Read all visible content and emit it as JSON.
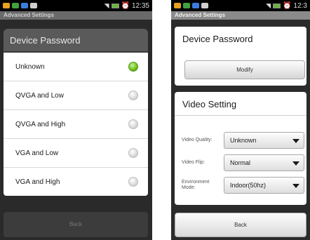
{
  "left": {
    "status_time": "12:35",
    "title": "Advanced Settings",
    "dialog_title": "Device Password",
    "options": [
      {
        "label": "Unknown",
        "selected": true
      },
      {
        "label": "QVGA and Low",
        "selected": false
      },
      {
        "label": "QVGA and High",
        "selected": false
      },
      {
        "label": "VGA and Low",
        "selected": false
      },
      {
        "label": "VGA and High",
        "selected": false
      }
    ],
    "back_label": "Back"
  },
  "right": {
    "status_time": "12:3",
    "title": "Advanced Settings",
    "password_title": "Device Password",
    "modify_label": "Modify",
    "video_title": "Video Setting",
    "rows": [
      {
        "label": "Video Quality:",
        "value": "Unknown"
      },
      {
        "label": "Video Flip:",
        "value": "Normal"
      },
      {
        "label": "Environment Mode:",
        "value": "Indoor(50hz)"
      }
    ],
    "back_label": "Back"
  },
  "colors": {
    "selected_radio": "#72c21f",
    "battery": "#6db33f"
  }
}
